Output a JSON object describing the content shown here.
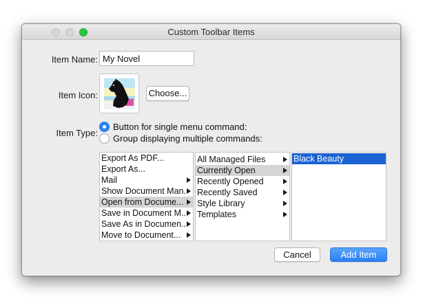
{
  "window": {
    "title": "Custom Toolbar Items"
  },
  "form": {
    "item_name_label": "Item Name:",
    "item_name_value": "My Novel",
    "item_icon_label": "Item Icon:",
    "choose_label": "Choose...",
    "item_type_label": "Item Type:",
    "options": [
      {
        "label": "Button for single menu command:",
        "selected": true
      },
      {
        "label": "Group displaying multiple commands:",
        "selected": false
      }
    ]
  },
  "browser": {
    "col1": [
      {
        "label": "Export As PDF...",
        "arrow": false
      },
      {
        "label": "Export As...",
        "arrow": false
      },
      {
        "label": "Mail",
        "arrow": true
      },
      {
        "label": "Show Document Man...",
        "arrow": true
      },
      {
        "label": "Open from Docume...",
        "arrow": true,
        "selected": true
      },
      {
        "label": "Save in Document M...",
        "arrow": true
      },
      {
        "label": "Save As in Documen...",
        "arrow": true
      },
      {
        "label": "Move to Document...",
        "arrow": true
      }
    ],
    "col2": [
      {
        "label": "All Managed Files",
        "arrow": true
      },
      {
        "label": "Currently Open",
        "arrow": true,
        "selected": true
      },
      {
        "label": "Recently Opened",
        "arrow": true
      },
      {
        "label": "Recently Saved",
        "arrow": true
      },
      {
        "label": "Style Library",
        "arrow": true
      },
      {
        "label": "Templates",
        "arrow": true
      }
    ],
    "col3": [
      {
        "label": "Black Beauty",
        "arrow": false,
        "selected": true
      }
    ]
  },
  "buttons": {
    "cancel": "Cancel",
    "add_item": "Add Item"
  },
  "colors": {
    "accent": "#2a7ff3",
    "selection": "#1a63d3",
    "zoom_green": "#2dc841"
  }
}
